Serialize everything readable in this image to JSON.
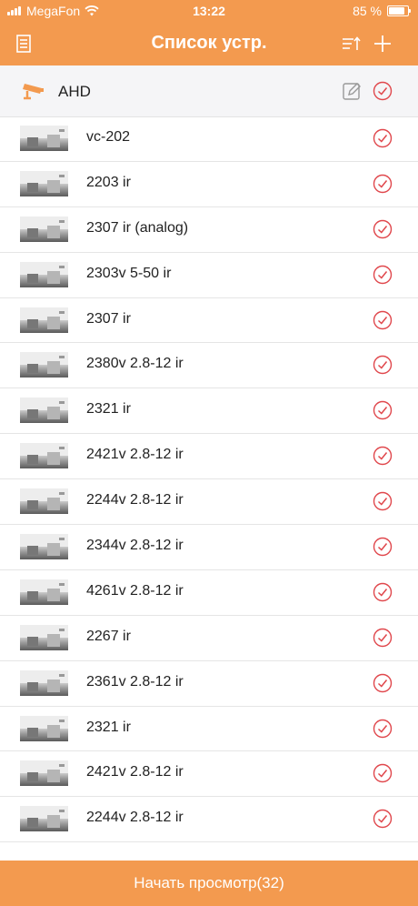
{
  "status_bar": {
    "carrier": "MegaFon",
    "time": "13:22",
    "battery": "85 %"
  },
  "header": {
    "title": "Список устр."
  },
  "group": {
    "label": "AHD"
  },
  "devices": [
    {
      "name": "vc-202"
    },
    {
      "name": "2203 ir"
    },
    {
      "name": "2307 ir (analog)"
    },
    {
      "name": "2303v 5-50 ir"
    },
    {
      "name": "2307 ir"
    },
    {
      "name": "2380v 2.8-12 ir"
    },
    {
      "name": "2321 ir"
    },
    {
      "name": "2421v 2.8-12 ir"
    },
    {
      "name": "2244v 2.8-12 ir"
    },
    {
      "name": "2344v 2.8-12 ir"
    },
    {
      "name": "4261v 2.8-12 ir"
    },
    {
      "name": "2267 ir"
    },
    {
      "name": "2361v 2.8-12 ir"
    },
    {
      "name": "2321 ir"
    },
    {
      "name": "2421v 2.8-12 ir"
    },
    {
      "name": "2244v 2.8-12 ir"
    }
  ],
  "footer": {
    "start_button": "Начать просмотр(32)"
  },
  "icons": {
    "menu": "document-list-icon",
    "sort": "sort-icon",
    "add": "plus-icon",
    "camera": "camera-icon",
    "edit": "edit-icon",
    "check": "check-circle-icon"
  },
  "colors": {
    "accent": "#f39a4f",
    "check": "#e0474c",
    "camera": "#f39a4f"
  }
}
